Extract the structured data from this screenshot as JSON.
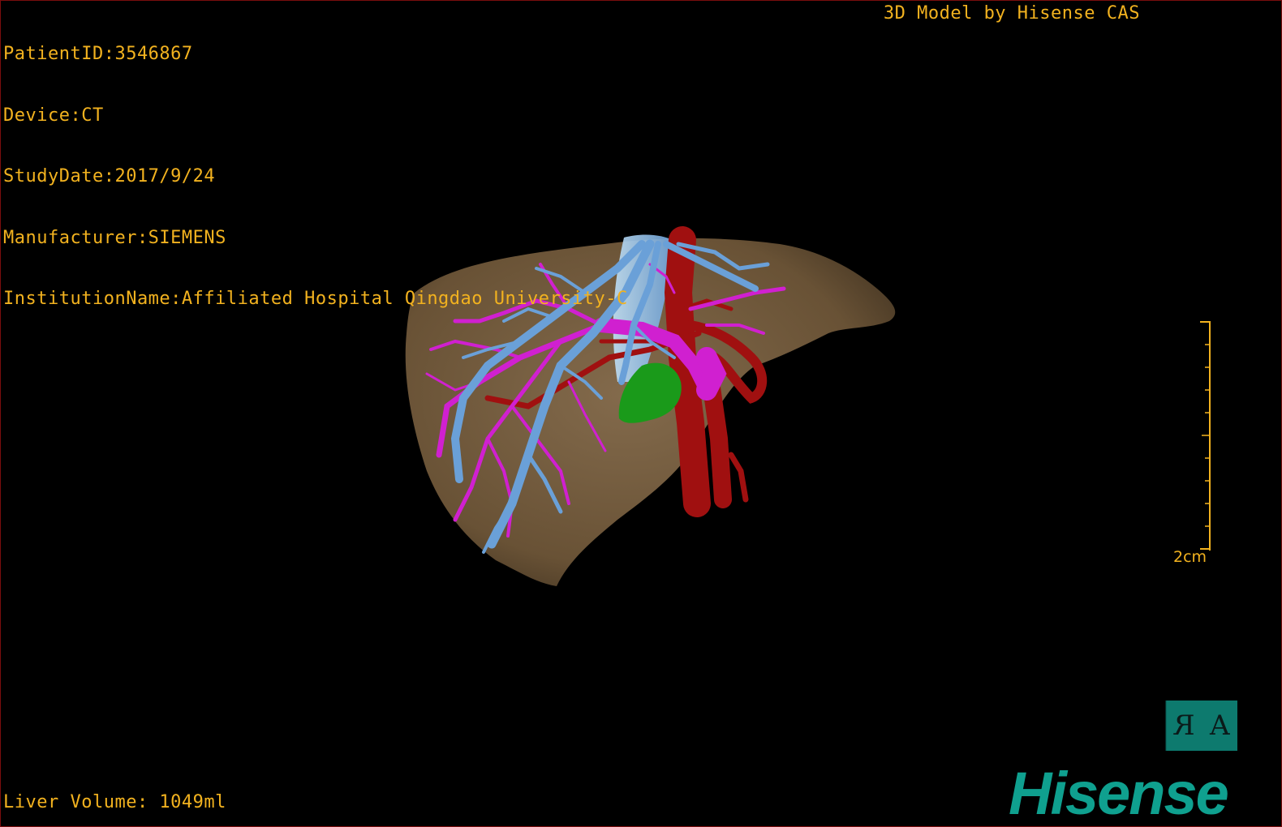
{
  "overlay": {
    "patient_id": "PatientID:3546867",
    "device": "Device:CT",
    "study_date": "StudyDate:2017/9/24",
    "manufacturer": "Manufacturer:SIEMENS",
    "institution": "InstitutionName:Affiliated Hospital Qingdao University-C",
    "credit": "3D Model by Hisense CAS",
    "liver_volume": "Liver Volume: 1049ml"
  },
  "scale": {
    "label": "2cm"
  },
  "orientation": {
    "left": "R",
    "right": "A"
  },
  "brand": {
    "logo_text": "Hisense"
  },
  "colors": {
    "overlay_text": "#f2b21f",
    "liver": "#7a6244",
    "hepatic_vein": "#6aa0d8",
    "portal_vein": "#d020d0",
    "artery": "#a01010",
    "gallbladder": "#1a9a1a",
    "brand": "#0fa08f"
  }
}
